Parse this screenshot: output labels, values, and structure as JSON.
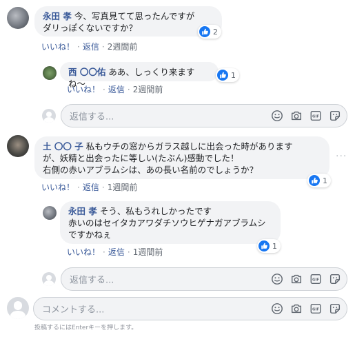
{
  "comments": [
    {
      "author": "永田 孝",
      "line1": "今、写真見てて思ったんですが",
      "line2": "ダリっぽくないですか？",
      "likes": "2",
      "like_label": "いいね！",
      "reply_label": "返信",
      "time": "2週間前"
    },
    {
      "author": "土 〇〇 子",
      "line1": "私もウチの窓からガラス越しに出会った時があります",
      "line2": "が、妖精と出会ったに等しい(たぶん)感動でした！",
      "line3": "右側の赤いアブラムシは、あの長い名前のでしょうか？",
      "likes": "1",
      "like_label": "いいね！",
      "reply_label": "返信",
      "time": "1週間前"
    }
  ],
  "replies": [
    {
      "author": "西 〇〇佑",
      "text": "ああ、しっくり来ますね〜",
      "likes": "1",
      "like_label": "いいね！",
      "reply_label": "返信",
      "time": "2週間前"
    },
    {
      "author": "永田 孝",
      "line1": "そう、私もうれしかったです",
      "line2": "赤いのはセイタカアワダチソウヒゲナガアブラムシ",
      "line3": "ですかねぇ",
      "likes": "1",
      "like_label": "いいね！",
      "reply_label": "返信",
      "time": "1週間前"
    }
  ],
  "reply_box": {
    "placeholder": "返信する..."
  },
  "comment_box": {
    "placeholder": "コメントする...",
    "hint": "投稿するにはEnterキーを押します。"
  },
  "icons": [
    "like-icon",
    "emoji-icon",
    "camera-icon",
    "gif-icon",
    "sticker-icon",
    "more-icon"
  ],
  "colors": {
    "link": "#385898",
    "like_blue": "#1877f2",
    "bubble_bg": "#f2f3f5"
  }
}
